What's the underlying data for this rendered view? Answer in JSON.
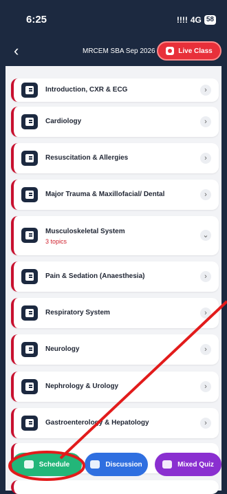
{
  "status_bar": {
    "time": "6:25",
    "signal": "!!!!",
    "network": "4G",
    "battery": "58"
  },
  "header": {
    "back_icon": "chevron-left-icon",
    "course_title": "MRCEM SBA Sep 2026",
    "live_button": "Live Class"
  },
  "topics": [
    {
      "title": "Introduction, CXR & ECG",
      "chevron": "›"
    },
    {
      "title": "Cardiology",
      "chevron": "›"
    },
    {
      "title": "Resuscitation & Allergies",
      "chevron": "›"
    },
    {
      "title": "Major Trauma & Maxillofacial/ Dental",
      "chevron": "›"
    },
    {
      "title": "Musculoskeletal System",
      "subtitle": "3 topics",
      "chevron": "⌄"
    },
    {
      "title": "Pain & Sedation (Anaesthesia)",
      "chevron": "›"
    },
    {
      "title": "Respiratory System",
      "chevron": "›"
    },
    {
      "title": "Neurology",
      "chevron": "›"
    },
    {
      "title": "Nephrology & Urology",
      "chevron": "›"
    },
    {
      "title": "Gastroenterology & Hepatology",
      "chevron": "›"
    }
  ],
  "bottom_bar": {
    "schedule": "Schedule",
    "discussion": "Discussion",
    "mixed_quiz": "Mixed Quiz"
  },
  "colors": {
    "header_bg": "#1c2940",
    "accent_red": "#c8102e",
    "schedule_green": "#23b679",
    "discussion_blue": "#2f6fe0",
    "quiz_purple": "#8a2fd0"
  }
}
